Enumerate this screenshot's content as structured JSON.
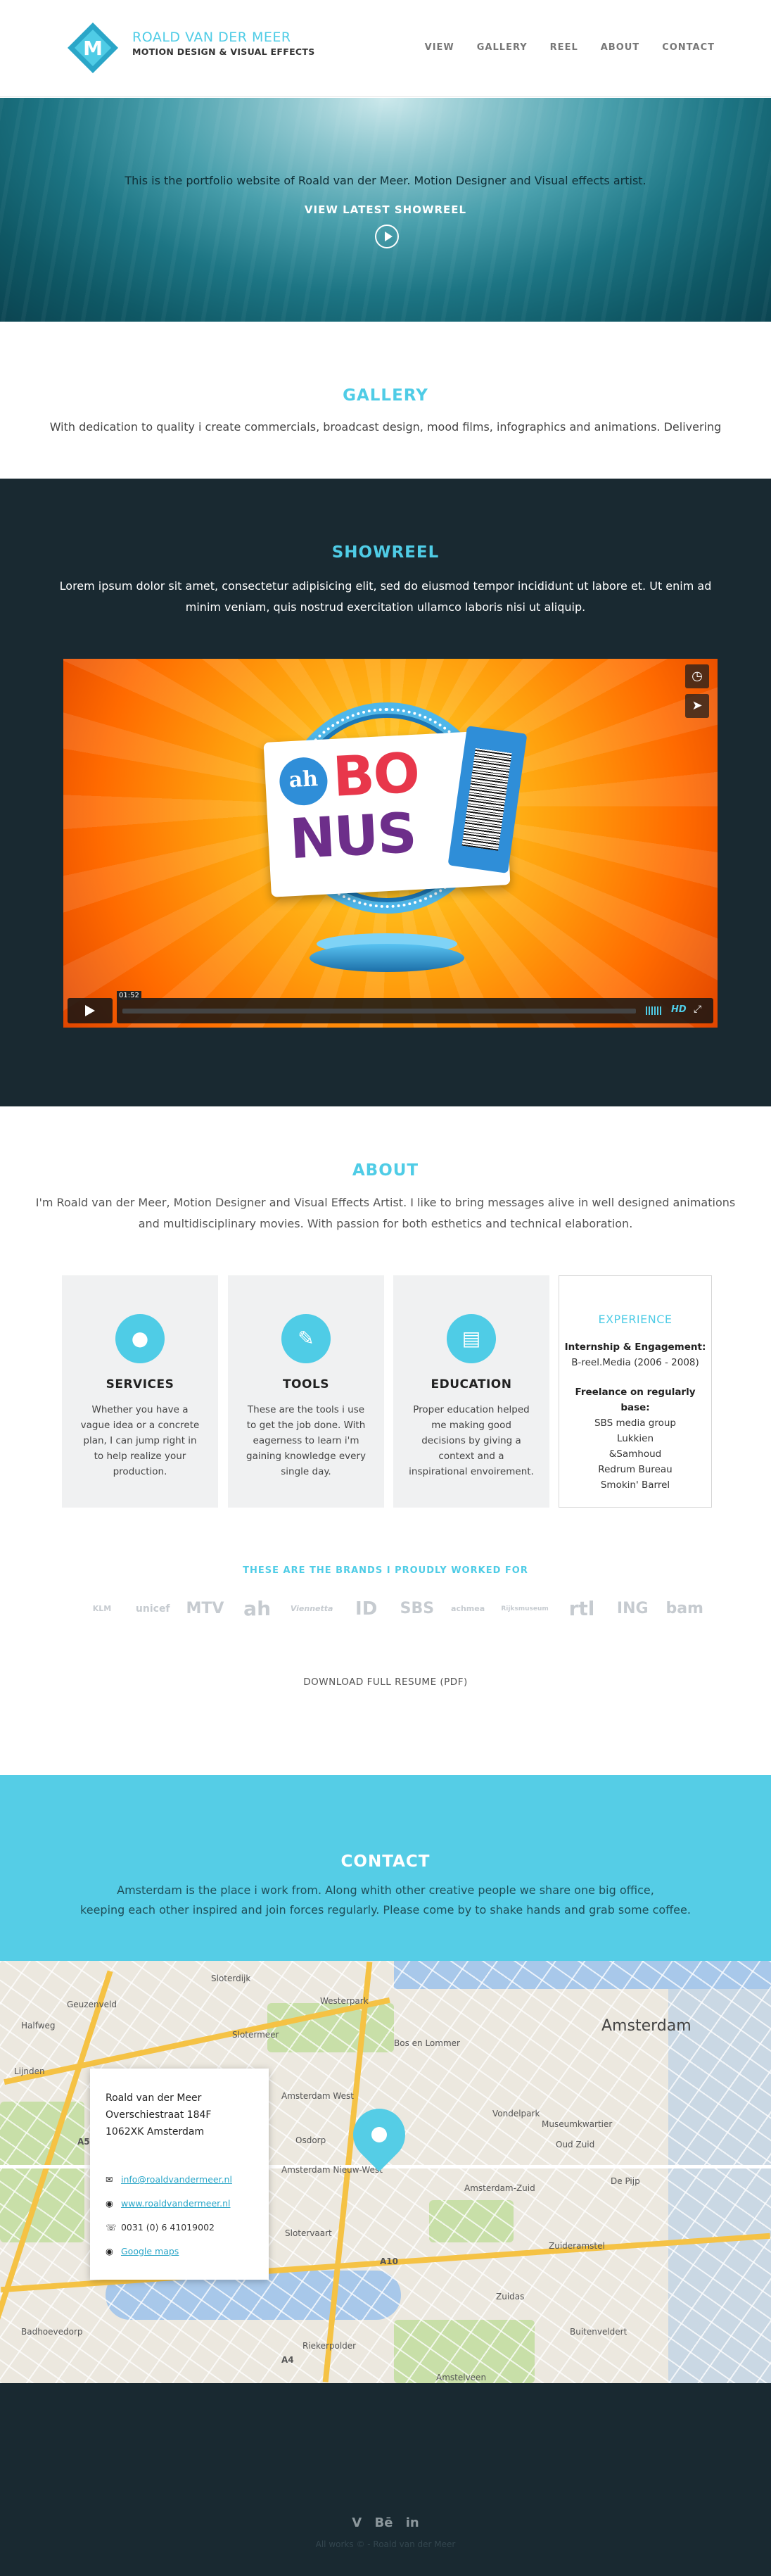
{
  "header": {
    "brand_name": "ROALD VAN DER MEER",
    "brand_tagline": "MOTION DESIGN & VISUAL EFFECTS",
    "nav": [
      "VIEW",
      "GALLERY",
      "REEL",
      "ABOUT",
      "CONTACT"
    ]
  },
  "hero": {
    "text": "This is the portfolio website of Roald van der Meer. Motion Designer and Visual effects artist.",
    "link": "VIEW LATEST SHOWREEL"
  },
  "gallery": {
    "title": "GALLERY",
    "text": "With dedication to quality i create commercials, broadcast design, mood films, infographics and animations. Delivering"
  },
  "showreel": {
    "title": "SHOWREEL",
    "text": "Lorem ipsum dolor sit amet, consectetur adipisicing elit, sed do eiusmod tempor incididunt ut labore et. Ut enim ad minim veniam, quis nostrud exercitation ullamco laboris nisi ut aliquip.",
    "video": {
      "logo": "ah",
      "word1": "BO",
      "word2": "NUS",
      "time": "01:52",
      "hd": "HD"
    }
  },
  "about": {
    "title": "ABOUT",
    "text": "I'm Roald van der Meer, Motion Designer and Visual Effects Artist. I like to bring messages alive in well designed animations and multidisciplinary movies. With passion for both esthetics and technical elaboration.",
    "cards": [
      {
        "title": "SERVICES",
        "text": "Whether you have a vague idea or a concrete plan, I can jump right in to help realize your production."
      },
      {
        "title": "TOOLS",
        "text": "These are the tools i use to get the job done. With eagerness to learn i'm gaining knowledge every single day."
      },
      {
        "title": "EDUCATION",
        "text": "Proper education helped me making good decisions by giving a context and a inspirational envoirement."
      }
    ],
    "experience": {
      "title": "EXPERIENCE",
      "heading1": "Internship & Engagement:",
      "item1": "B-reel.Media (2006 - 2008)",
      "heading2": "Freelance on regularly base:",
      "items": [
        "SBS media group",
        "Lukkien",
        "&Samhoud",
        "Redrum Bureau",
        "Smokin' Barrel"
      ]
    },
    "brands_title": "THESE ARE THE BRANDS I PROUDLY WORKED FOR",
    "brands": [
      "KLM",
      "unicef",
      "MTV",
      "ah",
      "Viennetta",
      "ID",
      "SBS",
      "achmea",
      "Rijksmuseum",
      "rtl",
      "ING",
      "bam"
    ],
    "resume": "DOWNLOAD FULL RESUME (PDF)"
  },
  "contact": {
    "title": "CONTACT",
    "line1": "Amsterdam is the place i work from. Along whith other creative people we share one big office,",
    "line2": "keeping each other inspired and join forces regularly. Please come by to shake hands and grab some coffee."
  },
  "map": {
    "name": "Roald van der Meer",
    "street": "Overschiestraat 184F",
    "postal": "1062XK Amsterdam",
    "email": "info@roaldvandermeer.nl",
    "website": "www.roaldvandermeer.nl",
    "phone": "0031 (0) 6 41019002",
    "maps": "Google maps",
    "labels": {
      "city": "Amsterdam",
      "westerpark": "Westerpark",
      "amsterdam_west": "Amsterdam West",
      "nieuwwest": "Amsterdam Nieuw-West",
      "zuid": "Amsterdam-Zuid",
      "oudzuid": "Oud Zuid",
      "depijp": "De Pijp",
      "zuideramstel": "Zuideramstel",
      "slotervaart": "Slotervaart",
      "vondelpark": "Vondelpark",
      "museumkwartier": "Museumkwartier",
      "amstelveen": "Amstelveen",
      "buitenveldert": "Buitenveldert",
      "zuidas": "Zuidas",
      "geuzenveld": "Geuzenveld",
      "osdorp": "Osdorp",
      "sloterdijk": "Sloterdijk",
      "bos_en_lommer": "Bos en Lommer",
      "slotermeer": "Slotermeer",
      "halfweg": "Halfweg",
      "lijnden": "Lijnden",
      "badhoevedorp": "Badhoevedorp",
      "riekerpolder": "Riekerpolder",
      "a10": "A10",
      "a4": "A4",
      "a5": "A5"
    }
  },
  "footer": {
    "social": [
      "V",
      "Bē",
      "in"
    ],
    "copyright": "All works © - Roald van der Meer"
  },
  "colors": {
    "accent": "#4fcce6",
    "dark": "#192931",
    "contact_bg": "#55cde6"
  }
}
